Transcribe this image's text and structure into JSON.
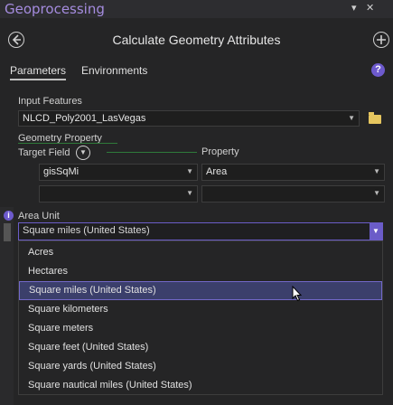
{
  "pane": {
    "title": "Geoprocessing",
    "controls": [
      "▾",
      "✕"
    ]
  },
  "tool": {
    "title": "Calculate Geometry Attributes",
    "back_icon": "back-arrow-icon",
    "add_icon": "add-icon"
  },
  "tabs": [
    {
      "label": "Parameters",
      "active": true
    },
    {
      "label": "Environments",
      "active": false
    }
  ],
  "input_features": {
    "label": "Input Features",
    "value": "NLCD_Poly2001_LasVegas"
  },
  "geometry_property": {
    "label": "Geometry Property",
    "target_field_label": "Target Field",
    "property_label": "Property",
    "rows": [
      {
        "field": "gisSqMi",
        "property": "Area"
      },
      {
        "field": "",
        "property": ""
      }
    ]
  },
  "area_unit": {
    "label": "Area Unit",
    "selected": "Square miles (United States)",
    "options": [
      "Acres",
      "Hectares",
      "Square miles (United States)",
      "Square kilometers",
      "Square meters",
      "Square feet (United States)",
      "Square yards (United States)",
      "Square nautical miles (United States)"
    ],
    "highlight_index": 2
  },
  "colors": {
    "accent": "#6b5cc8",
    "title": "#a58cdf",
    "background": "#252526",
    "selection": "#3b3f6b"
  }
}
